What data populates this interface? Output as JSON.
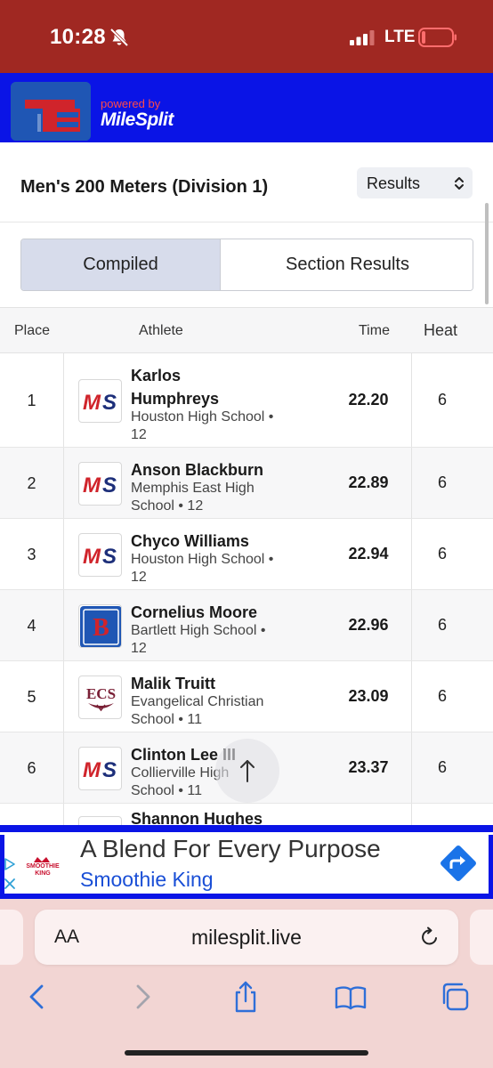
{
  "status_bar": {
    "time": "10:28",
    "network": "LTE"
  },
  "header": {
    "powered_by": "powered by",
    "brand": "MileSplit"
  },
  "event": {
    "title": "Men's 200 Meters (Division 1)",
    "view_select": "Results"
  },
  "tabs": {
    "compiled": "Compiled",
    "section_results": "Section Results",
    "active": "Compiled"
  },
  "table": {
    "headers": {
      "place": "Place",
      "athlete": "Athlete",
      "time": "Time",
      "heat": "Heat"
    },
    "rows": [
      {
        "place": "1",
        "name": "Karlos Humphreys",
        "school": "Houston High School • 12",
        "time": "22.20",
        "heat": "6",
        "logo": "milesplit-ms-logo"
      },
      {
        "place": "2",
        "name": "Anson Blackburn",
        "school": "Memphis East High School • 12",
        "time": "22.89",
        "heat": "6",
        "logo": "milesplit-ms-logo"
      },
      {
        "place": "3",
        "name": "Chyco Williams",
        "school": "Houston High School • 12",
        "time": "22.94",
        "heat": "6",
        "logo": "milesplit-ms-logo"
      },
      {
        "place": "4",
        "name": "Cornelius Moore",
        "school": "Bartlett High School • 12",
        "time": "22.96",
        "heat": "6",
        "logo": "bartlett-b-logo"
      },
      {
        "place": "5",
        "name": "Malik Truitt",
        "school": "Evangelical Christian School • 11",
        "time": "23.09",
        "heat": "6",
        "logo": "ecs-logo"
      },
      {
        "place": "6",
        "name": "Clinton Lee III",
        "school": "Collierville High School • 11",
        "time": "23.37",
        "heat": "6",
        "logo": "milesplit-ms-logo"
      },
      {
        "place": "",
        "name": "Shannon Hughes",
        "school": "",
        "time": "",
        "heat": "",
        "logo": "milesplit-ms-logo"
      }
    ]
  },
  "ad": {
    "headline": "A Blend For Every Purpose",
    "advertiser": "Smoothie King",
    "logo_text": "SMOOTHIE KING"
  },
  "browser": {
    "aa_label": "AA",
    "url": "milesplit.live"
  },
  "colors": {
    "status_bar": "#a02822",
    "header_band": "#0a14e6",
    "tab_active": "#d7dceb",
    "browser_chrome": "#f2d5d3",
    "ms_red": "#d0242b",
    "ms_navy": "#1d2f7a",
    "link_blue": "#1a4fd6"
  }
}
